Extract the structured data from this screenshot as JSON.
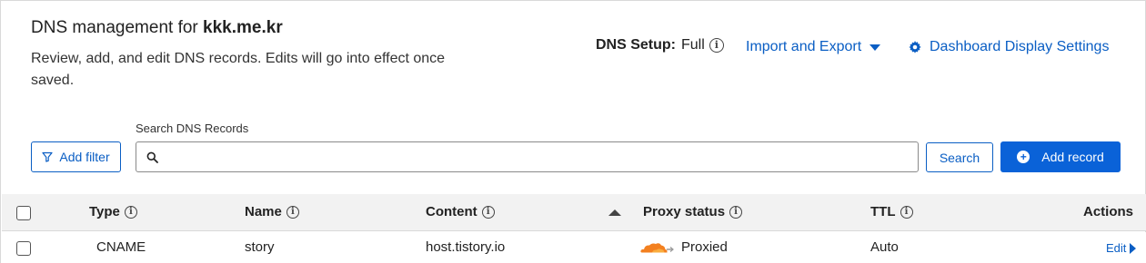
{
  "header": {
    "title_prefix": "DNS management for",
    "domain": "kkk.me.kr",
    "description": "Review, add, and edit DNS records. Edits will go into effect once saved.",
    "dns_setup_label": "DNS Setup:",
    "dns_setup_value": "Full",
    "import_export_label": "Import and Export",
    "display_settings_label": "Dashboard Display Settings"
  },
  "toolbar": {
    "add_filter_label": "Add filter",
    "search_label": "Search DNS Records",
    "search_value": "",
    "search_button_label": "Search",
    "add_record_label": "Add record"
  },
  "table": {
    "columns": {
      "type": "Type",
      "name": "Name",
      "content": "Content",
      "proxy_status": "Proxy status",
      "ttl": "TTL",
      "actions": "Actions"
    },
    "sorted_column": "content",
    "rows": [
      {
        "type": "CNAME",
        "name": "story",
        "content": "host.tistory.io",
        "proxy_status": "Proxied",
        "ttl": "Auto",
        "action": "Edit"
      }
    ]
  },
  "colors": {
    "accent": "#0a5ec4",
    "primary_button": "#0a62d8",
    "proxied_cloud": "#f38020",
    "header_bg": "#f2f2f2"
  },
  "icons": {
    "info": "info-icon",
    "caret": "caret-down-icon",
    "gear": "gear-icon",
    "filter": "filter-icon",
    "search": "search-icon",
    "add": "plus-circle-icon",
    "sort": "sort-ascending-icon",
    "proxied": "orange-cloud-icon",
    "edit": "caret-right-icon"
  }
}
